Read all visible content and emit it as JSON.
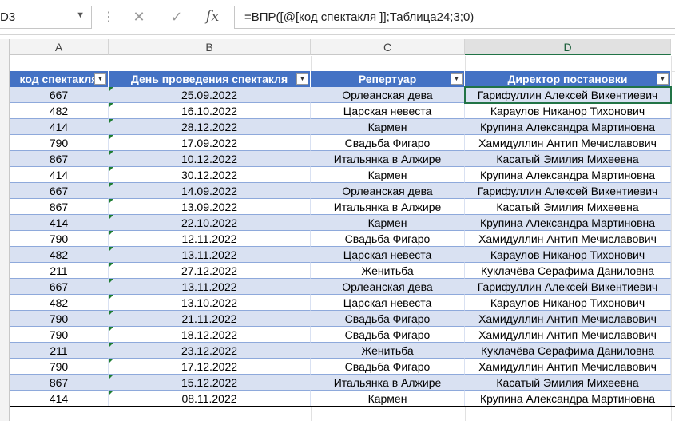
{
  "name_box": {
    "value": "D3",
    "dropdown_icon": "chevron-down-icon"
  },
  "formula_bar": {
    "cancel_icon": "cancel-icon",
    "enter_icon": "check-icon",
    "fx_label": "fx",
    "formula": "=ВПР([@[код спектакля ]];Таблица24;3;0)"
  },
  "columns": [
    "A",
    "B",
    "C",
    "D"
  ],
  "selected_column": "D",
  "table": {
    "header_color": "#4472c4",
    "band_color": "#d9e1f2",
    "headers": [
      "код спектакля",
      "День проведения спектакля",
      "Репертуар",
      "Директор постановки"
    ],
    "rows": [
      [
        "667",
        "25.09.2022",
        "Орлеанская дева",
        "Гарифуллин Алексей Викентиевич"
      ],
      [
        "482",
        "16.10.2022",
        "Царская невеста",
        "Караулов Никанор Тихонович"
      ],
      [
        "414",
        "28.12.2022",
        "Кармен",
        "Крупина Александра Мартиновна"
      ],
      [
        "790",
        "17.09.2022",
        "Свадьба Фигаро",
        "Хамидуллин Антип Мечиславович"
      ],
      [
        "867",
        "10.12.2022",
        "Итальянка в Алжире",
        "Касатый Эмилия Михеевна"
      ],
      [
        "414",
        "30.12.2022",
        "Кармен",
        "Крупина Александра Мартиновна"
      ],
      [
        "667",
        "14.09.2022",
        "Орлеанская дева",
        "Гарифуллин Алексей Викентиевич"
      ],
      [
        "867",
        "13.09.2022",
        "Итальянка в Алжире",
        "Касатый Эмилия Михеевна"
      ],
      [
        "414",
        "22.10.2022",
        "Кармен",
        "Крупина Александра Мартиновна"
      ],
      [
        "790",
        "12.11.2022",
        "Свадьба Фигаро",
        "Хамидуллин Антип Мечиславович"
      ],
      [
        "482",
        "13.11.2022",
        "Царская невеста",
        "Караулов Никанор Тихонович"
      ],
      [
        "211",
        "27.12.2022",
        "Женитьба",
        "Куклачёва Серафима Даниловна"
      ],
      [
        "667",
        "13.11.2022",
        "Орлеанская дева",
        "Гарифуллин Алексей Викентиевич"
      ],
      [
        "482",
        "13.10.2022",
        "Царская невеста",
        "Караулов Никанор Тихонович"
      ],
      [
        "790",
        "21.11.2022",
        "Свадьба Фигаро",
        "Хамидуллин Антип Мечиславович"
      ],
      [
        "790",
        "18.12.2022",
        "Свадьба Фигаро",
        "Хамидуллин Антип Мечиславович"
      ],
      [
        "211",
        "23.12.2022",
        "Женитьба",
        "Куклачёва Серафима Даниловна"
      ],
      [
        "790",
        "17.12.2022",
        "Свадьба Фигаро",
        "Хамидуллин Антип Мечиславович"
      ],
      [
        "867",
        "15.12.2022",
        "Итальянка в Алжире",
        "Касатый Эмилия Михеевна"
      ],
      [
        "414",
        "08.11.2022",
        "Кармен",
        "Крупина Александра Мартиновна"
      ]
    ]
  }
}
